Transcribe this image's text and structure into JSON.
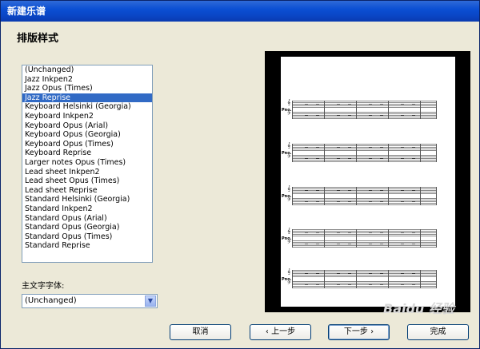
{
  "window": {
    "title": "新建乐谱"
  },
  "page": {
    "subtitle": "排版样式"
  },
  "style_list": {
    "items": [
      "(Unchanged)",
      "Jazz Inkpen2",
      "Jazz Opus (Times)",
      "Jazz Reprise",
      "Keyboard Helsinki (Georgia)",
      "Keyboard Inkpen2",
      "Keyboard Opus (Arial)",
      "Keyboard Opus (Georgia)",
      "Keyboard Opus (Times)",
      "Keyboard Reprise",
      "Larger notes Opus (Times)",
      "Lead sheet Inkpen2",
      "Lead sheet Opus (Times)",
      "Lead sheet Reprise",
      "Standard Helsinki (Georgia)",
      "Standard Inkpen2",
      "Standard Opus (Arial)",
      "Standard Opus (Georgia)",
      "Standard Opus (Times)",
      "Standard Reprise"
    ],
    "selected_index": 3
  },
  "font_selector": {
    "label": "主文字字体:",
    "value": "(Unchanged)"
  },
  "buttons": {
    "cancel": "取消",
    "back": "‹ 上一步",
    "next": "下一步 ›",
    "finish": "完成"
  },
  "watermark": "Baidu 经验"
}
